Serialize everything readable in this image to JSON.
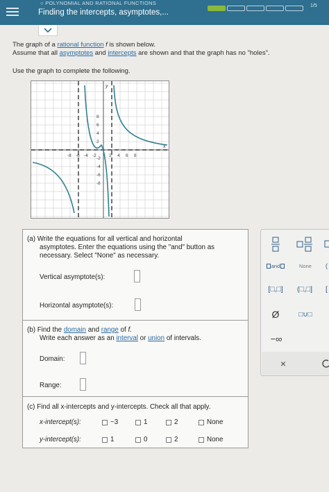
{
  "header": {
    "topic": "POLYNOMIAL AND RATIONAL FUNCTIONS",
    "title": "Finding the intercepts, asymptotes,...",
    "progress_count": "1/5"
  },
  "intro": {
    "line1_pre": "The graph of a ",
    "line1_link": "rational function",
    "line1_var": "f",
    "line1_post": " is shown below.",
    "line2_pre": "Assume that all ",
    "line2_link1": "asymptotes",
    "line2_mid": " and ",
    "line2_link2": "intercepts",
    "line2_post": " are shown and that the graph has no \"holes\".",
    "instruction": "Use the graph to complete the following."
  },
  "graph": {
    "x_ticks": [
      "-8",
      "-6",
      "-4",
      "-2",
      "2",
      "4",
      "6",
      "8"
    ],
    "y_ticks": [
      "8",
      "6",
      "4",
      "2",
      "-2",
      "-4",
      "-6",
      "-8"
    ],
    "x_label": "x",
    "y_label": "y"
  },
  "part_a": {
    "line1": "(a)  Write the equations for all vertical and horizontal",
    "line2": "asymptotes. Enter the equations using the \"and\" button as",
    "line3": "necessary. Select \"None\" as necessary.",
    "vertical_label": "Vertical asymptote(s):",
    "horizontal_label": "Horizontal asymptote(s):"
  },
  "part_b": {
    "line1_pre": "(b)  Find the ",
    "line1_link1": "domain",
    "line1_mid": " and ",
    "line1_link2": "range",
    "line1_post": " of ",
    "line1_var": "f.",
    "line2_pre": "Write each answer as an ",
    "line2_link1": "interval",
    "line2_mid": " or ",
    "line2_link2": "union",
    "line2_post": " of intervals.",
    "domain_label": "Domain:",
    "range_label": "Range:"
  },
  "part_c": {
    "line1": "(c)  Find all x-intercepts and y-intercepts. Check all that apply.",
    "x_label": "x-intercept(s):",
    "x_options": [
      "−3",
      "1",
      "2",
      "None"
    ],
    "y_label": "y-intercept(s):",
    "y_options": [
      "1",
      "0",
      "2",
      "None"
    ]
  },
  "palette": {
    "and_label": "and",
    "none_label": "None",
    "closed_interval": "[□,□]",
    "open_closed_interval": "(□,□]",
    "empty_set": "Ø",
    "union": "□∪□",
    "neg_infinity": "−∞",
    "clear": "×"
  },
  "colors": {
    "header": "#2f6f8f",
    "link": "#2a6aa3",
    "curve": "#2f7f8f",
    "progress_filled": "#8ab83d"
  }
}
